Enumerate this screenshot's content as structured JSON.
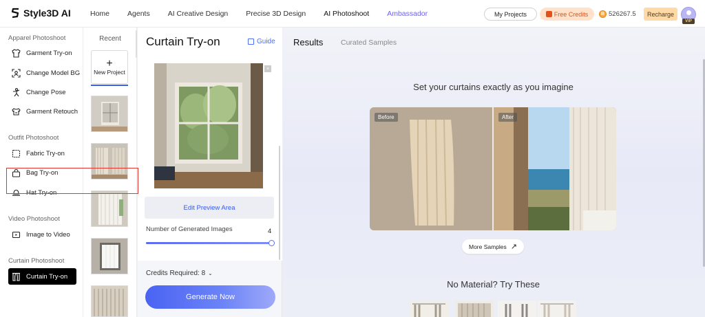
{
  "brand": {
    "name": "Style3D AI"
  },
  "nav": {
    "items": [
      "Home",
      "Agents",
      "AI Creative Design",
      "Precise 3D Design",
      "AI Photoshoot",
      "Ambassador"
    ],
    "my_projects": "My Projects",
    "free_credits": "Free Credits",
    "credits_balance": "526267.5",
    "recharge": "Recharge",
    "vip_badge": "VIP"
  },
  "sidebar": {
    "sections": [
      {
        "title": "Apparel Photoshoot",
        "items": [
          "Garment Try-on",
          "Change Model BG",
          "Change Pose",
          "Garment Retouch"
        ]
      },
      {
        "title": "Outfit Photoshoot",
        "items": [
          "Fabric Try-on",
          "Bag Try-on",
          "Hat Try-on"
        ]
      },
      {
        "title": "Video Photoshoot",
        "items": [
          "Image to Video"
        ]
      },
      {
        "title": "Curtain Photoshoot",
        "items": [
          "Curtain Try-on"
        ]
      }
    ],
    "active_item": "Curtain Try-on"
  },
  "recent": {
    "title": "Recent",
    "new_project": "New Project"
  },
  "panel": {
    "title": "Curtain Try-on",
    "guide": "Guide",
    "edit_button": "Edit Preview Area",
    "num_images_label": "Number of Generated Images",
    "num_images_value": "4",
    "credits_label": "Credits Required: 8",
    "generate_button": "Generate Now"
  },
  "results": {
    "tab_results": "Results",
    "tab_curated": "Curated Samples",
    "hero_title": "Set your curtains exactly as you imagine",
    "before_label": "Before",
    "after_label": "After",
    "more_samples": "More Samples",
    "no_material": "No Material? Try These"
  },
  "colors": {
    "accent": "#4a63f3",
    "highlight_outline": "#e1352e",
    "ambassador": "#6c63e8",
    "credits_orange": "#e0521b"
  }
}
